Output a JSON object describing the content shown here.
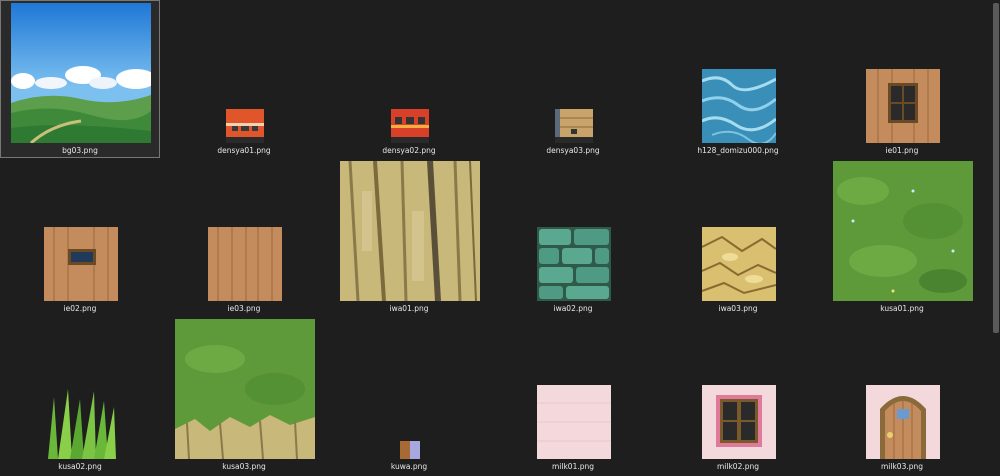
{
  "files": [
    {
      "name": "bg03.png",
      "icon": "sky-landscape-image",
      "selected": true
    },
    {
      "name": "densya01.png",
      "icon": "train-car-orange-image"
    },
    {
      "name": "densya02.png",
      "icon": "train-car-red-image"
    },
    {
      "name": "densya03.png",
      "icon": "train-car-wooden-image"
    },
    {
      "name": "h128_domizu000.png",
      "icon": "water-texture-image"
    },
    {
      "name": "ie01.png",
      "icon": "wooden-wall-window-image"
    },
    {
      "name": "ie02.png",
      "icon": "wooden-wall-small-window-image"
    },
    {
      "name": "ie03.png",
      "icon": "wooden-plank-texture-image"
    },
    {
      "name": "iwa01.png",
      "icon": "cliff-rock-texture-image"
    },
    {
      "name": "iwa02.png",
      "icon": "stone-wall-texture-image"
    },
    {
      "name": "iwa03.png",
      "icon": "yellow-rock-texture-image"
    },
    {
      "name": "kusa01.png",
      "icon": "grass-field-texture-image"
    },
    {
      "name": "kusa02.png",
      "icon": "tall-grass-image"
    },
    {
      "name": "kusa03.png",
      "icon": "grass-cliff-texture-image"
    },
    {
      "name": "kuwa.png",
      "icon": "hoe-tool-image"
    },
    {
      "name": "milk01.png",
      "icon": "pink-wall-texture-image"
    },
    {
      "name": "milk02.png",
      "icon": "pink-wall-window-image"
    },
    {
      "name": "milk03.png",
      "icon": "arched-wooden-door-image"
    }
  ]
}
